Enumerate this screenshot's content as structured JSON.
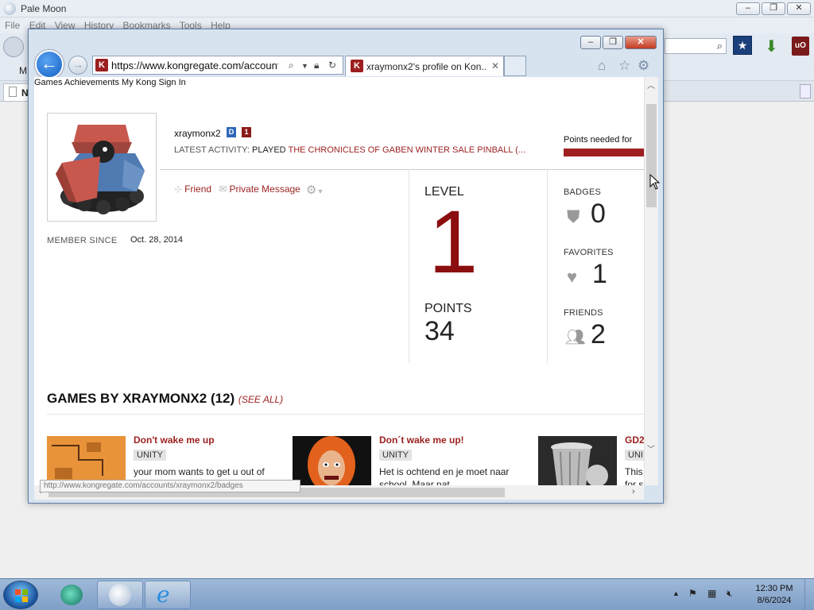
{
  "paleMoon": {
    "title": "Pale Moon",
    "menu": [
      "File",
      "Edit",
      "View",
      "History",
      "Bookmarks",
      "Tools",
      "Help"
    ],
    "bookmark_letter": "M",
    "tab_letter": "N"
  },
  "ie": {
    "url": "https://www.kongregate.com/accounts/x",
    "tab_title": "xraymonx2's profile on Kon...",
    "favicon_letter": "K"
  },
  "page": {
    "topnav": "Games Achievements My Kong Sign In",
    "username": "xraymonx2",
    "badge_d": "D",
    "badge_level": "1",
    "latest_label": "LATEST ACTIVITY:",
    "latest_action": "PLAYED",
    "latest_game": "THE CHRONICLES OF GABEN WINTER SALE PINBALL (...",
    "points_needed": "Points needed for",
    "friend_label": "Friend",
    "message_label": "Private Message",
    "member_since_label": "MEMBER SINCE",
    "member_since": "Oct. 28, 2014",
    "level_label": "LEVEL",
    "level": "1",
    "points_label": "POINTS",
    "points": "34",
    "badges_label": "BADGES",
    "badges": "0",
    "favorites_label": "FAVORITES",
    "favorites": "1",
    "friends_label": "FRIENDS",
    "friends": "2",
    "games_heading": "GAMES BY XRAYMONX2 (12)",
    "see_all": "(SEE ALL)",
    "games": [
      {
        "title": "Don't wake me up",
        "tag": "UNITY",
        "desc": "your mom wants to get u out of your bed stop th..."
      },
      {
        "title": "Don´t wake me up!",
        "tag": "UNITY",
        "desc": "Het is ochtend en je moet naar school. Maar nat..."
      },
      {
        "title": "GD2",
        "tag": "UNI",
        "desc": "This for s"
      }
    ],
    "status_url": "http://www.kongregate.com/accounts/xraymonx2/badges"
  },
  "taskbar": {
    "time": "12:30 PM",
    "date": "8/6/2024"
  }
}
